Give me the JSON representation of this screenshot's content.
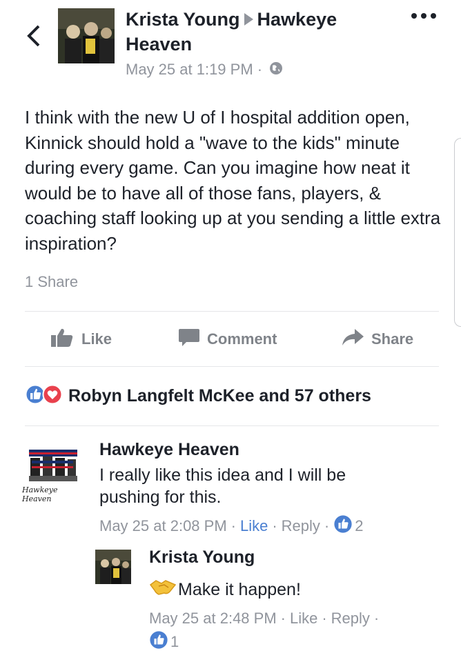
{
  "post": {
    "author": "Krista Young",
    "target": "Hawkeye",
    "target_line2": "Heaven",
    "timestamp": "May 25 at 1:19 PM",
    "separator": "·",
    "text": "I think with the new U of I hospital addition open, Kinnick should hold a \"wave to the kids\" minute during every game.  Can you imagine how neat it would be to have all of those fans, players, & coaching staff looking up at you sending a little extra inspiration?",
    "shares": "1 Share"
  },
  "actions": {
    "like": "Like",
    "comment": "Comment",
    "share": "Share"
  },
  "reactions": {
    "summary": "Robyn Langfelt McKee and 57 others"
  },
  "comments": [
    {
      "author": "Hawkeye Heaven",
      "text_line1": "I really like this idea and I will be",
      "text_line2": "pushing for this.",
      "timestamp": "May 25 at 2:08 PM",
      "like_label": "Like",
      "reply_label": "Reply",
      "like_count": "2",
      "avatar_caption": "Hawkeye Heaven"
    },
    {
      "author": "Krista Young",
      "text": "Make it happen!",
      "timestamp": "May 25 at 2:48 PM",
      "like_label": "Like",
      "reply_label": "Reply",
      "like_count": "1"
    }
  ],
  "colors": {
    "text": "#1d2129",
    "meta": "#90949c",
    "like_blue": "#4a7fd1",
    "love_red": "#e9414d",
    "action_gray": "#7f8389"
  },
  "icons": [
    "back-chevron-icon",
    "more-dots-icon",
    "globe-icon",
    "thumbs-up-icon",
    "comment-bubble-icon",
    "share-arrow-icon",
    "like-reaction-icon",
    "love-reaction-icon",
    "handshake-icon"
  ]
}
